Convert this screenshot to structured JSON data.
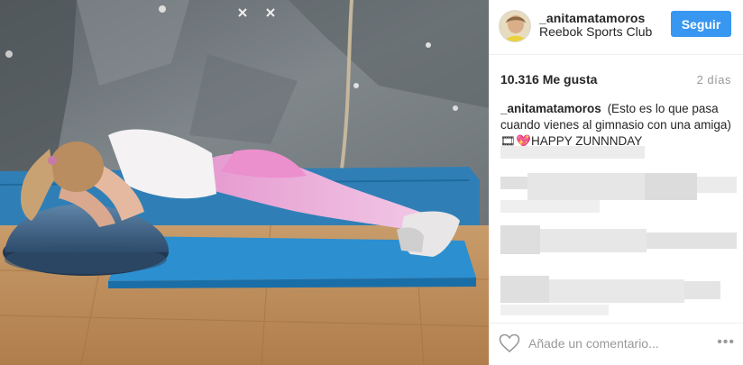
{
  "post": {
    "username": "_anitamatamoros",
    "location": "Reebok Sports Club",
    "follow_label": "Seguir",
    "likes": "10.316 Me gusta",
    "time": "2 días",
    "caption_user": "_anitamatamoros",
    "caption_text": "(Esto es lo que pasa cuando vienes al gimnasio con una amiga) 🎞💖HAPPY ZUNNNDAY"
  },
  "footer": {
    "comment_placeholder": "Añade un comentario...",
    "more_label": "•••"
  },
  "icons": {
    "like": "heart-icon",
    "more": "more-options-icon"
  },
  "colors": {
    "follow_button": "#3897f0",
    "divider": "#efefef",
    "muted_text": "#999999"
  }
}
